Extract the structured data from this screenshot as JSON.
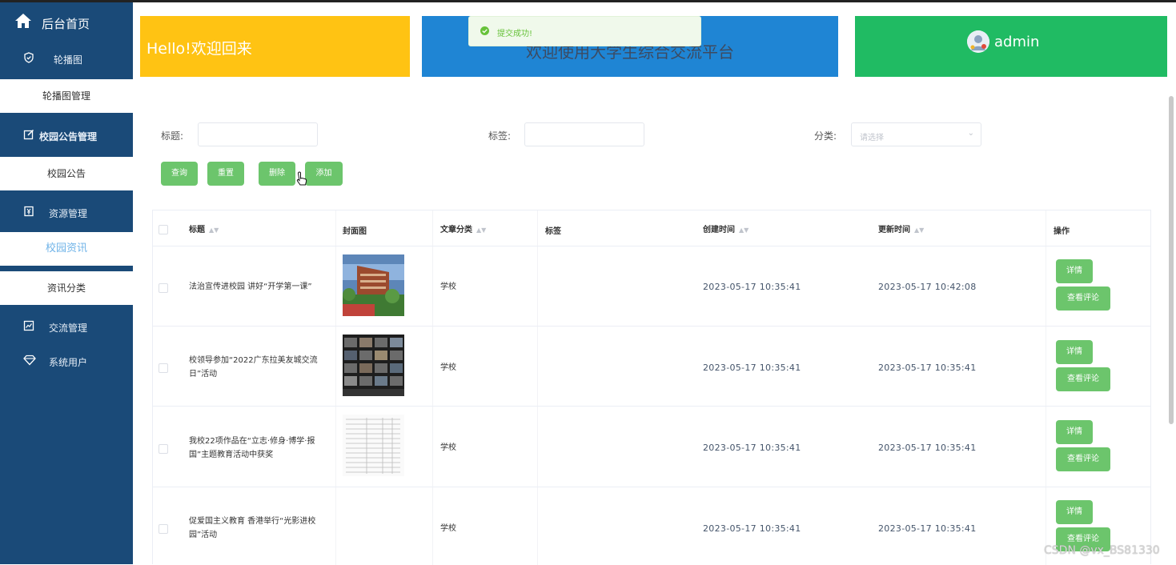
{
  "sidebar": {
    "home": "后台首页",
    "groups": [
      {
        "label": "轮播图",
        "icon": "shield-icon"
      },
      {
        "label": "校园公告管理",
        "icon": "edit-icon"
      },
      {
        "label": "资源管理",
        "icon": "yen-doc-icon"
      },
      {
        "label": "交流管理",
        "icon": "chart-icon"
      },
      {
        "label": "系统用户",
        "icon": "diamond-icon"
      }
    ],
    "subs": [
      "轮播图管理",
      "校园公告",
      "校园资讯",
      "资讯分类"
    ]
  },
  "banners": {
    "welcome": "Hello!欢迎回来",
    "platform": "欢迎使用大学生综合交流平台",
    "user": "admin"
  },
  "toast": "提交成功!",
  "filters": {
    "title_label": "标题:",
    "tag_label": "标签:",
    "category_label": "分类:",
    "category_placeholder": "请选择"
  },
  "buttons": {
    "query": "查询",
    "reset": "重置",
    "delete": "删除",
    "add": "添加"
  },
  "table": {
    "headers": [
      "标题",
      "封面图",
      "文章分类",
      "标签",
      "创建时间",
      "更新时间",
      "操作"
    ],
    "rows": [
      {
        "title": "法治宣传进校园 讲好“开学第一课”",
        "category": "学校",
        "tag": "",
        "created": "2023-05-17 10:35:41",
        "updated": "2023-05-17 10:42:08"
      },
      {
        "title": "校领导参加“2022广东拉美友城交流日”活动",
        "category": "学校",
        "tag": "",
        "created": "2023-05-17 10:35:41",
        "updated": "2023-05-17 10:35:41"
      },
      {
        "title": "我校22项作品在“立志·修身·博学·报国”主题教育活动中获奖",
        "category": "学校",
        "tag": "",
        "created": "2023-05-17 10:35:41",
        "updated": "2023-05-17 10:35:41"
      },
      {
        "title": "促爱国主义教育 香港举行“光影进校园”活动",
        "category": "学校",
        "tag": "",
        "created": "2023-05-17 10:35:41",
        "updated": "2023-05-17 10:35:41"
      }
    ],
    "action_detail": "详情",
    "action_comments": "查看评论"
  },
  "watermark": "CSDN @vx_BS81330",
  "colors": {
    "sidebar": "#1a4a78",
    "yellow": "#ffc313",
    "blue": "#1f85d4",
    "green": "#20bb63",
    "button": "#6cc56c"
  }
}
